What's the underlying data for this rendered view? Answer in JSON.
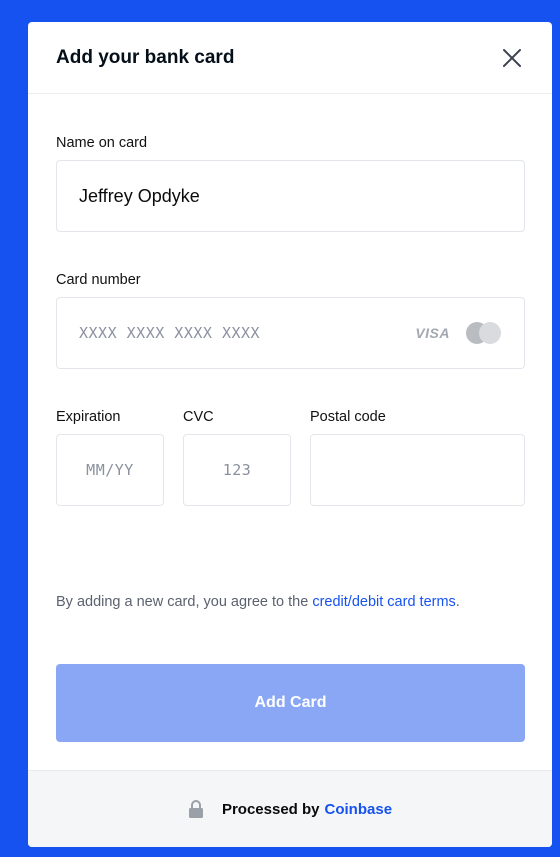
{
  "modal": {
    "title": "Add your bank card",
    "close_icon": "close-icon"
  },
  "form": {
    "name_label": "Name on card",
    "name_value": "Jeffrey Opdyke",
    "card_label": "Card number",
    "card_placeholder": "XXXX XXXX XXXX XXXX",
    "card_brands": [
      "VISA",
      "mastercard-icon"
    ],
    "expiration_label": "Expiration",
    "expiration_placeholder": "MM/YY",
    "cvc_label": "CVC",
    "cvc_placeholder": "123",
    "postal_label": "Postal code",
    "postal_value": ""
  },
  "terms": {
    "prefix": "By adding a new card, you agree to the ",
    "link": "credit/debit card terms",
    "suffix": "."
  },
  "actions": {
    "add_card_label": "Add Card"
  },
  "footer": {
    "processed_by": "Processed by",
    "provider": "Coinbase",
    "lock_icon": "lock-icon"
  },
  "colors": {
    "background": "#1652f0",
    "link": "#1652f0",
    "button_disabled": "#8aa7f5"
  }
}
